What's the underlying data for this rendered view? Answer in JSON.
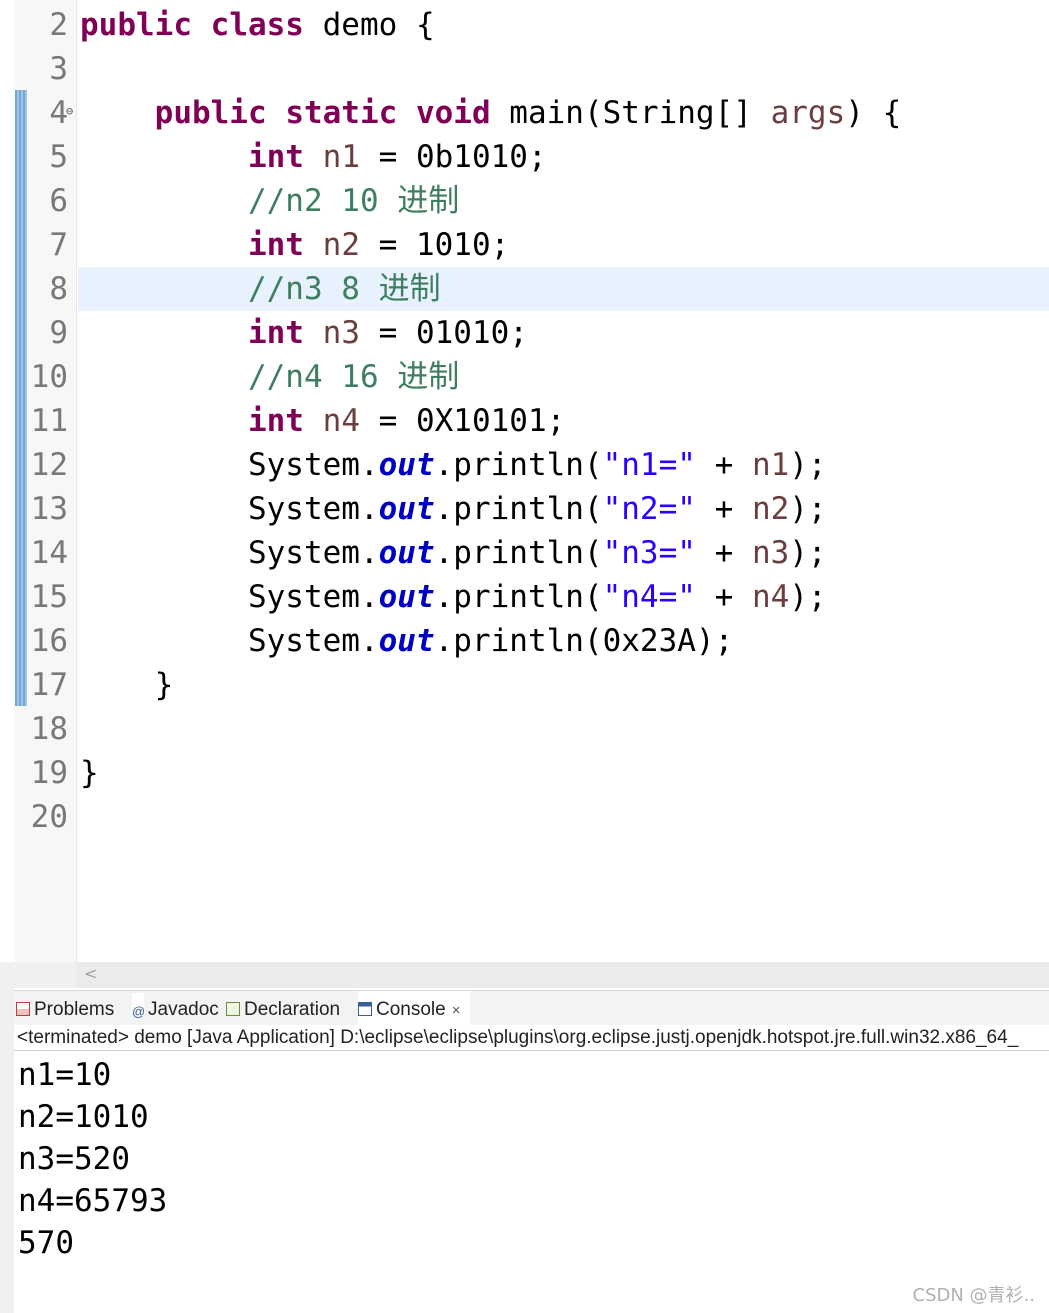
{
  "editor": {
    "highlighted_line": "8",
    "lines": [
      {
        "n": "2",
        "tokens": [
          {
            "t": "public",
            "c": "kw"
          },
          {
            "t": " "
          },
          {
            "t": "class",
            "c": "kw"
          },
          {
            "t": " demo {"
          }
        ]
      },
      {
        "n": "3",
        "tokens": []
      },
      {
        "n": "4",
        "fold": "⊖",
        "tokens": [
          {
            "t": "    "
          },
          {
            "t": "public",
            "c": "kw"
          },
          {
            "t": " "
          },
          {
            "t": "static",
            "c": "kw"
          },
          {
            "t": " "
          },
          {
            "t": "void",
            "c": "kw"
          },
          {
            "t": " main(String[] "
          },
          {
            "t": "args",
            "c": "var"
          },
          {
            "t": ") {"
          }
        ]
      },
      {
        "n": "5",
        "tokens": [
          {
            "t": "         "
          },
          {
            "t": "int",
            "c": "kw"
          },
          {
            "t": " "
          },
          {
            "t": "n1",
            "c": "var"
          },
          {
            "t": " = 0b1010;"
          }
        ]
      },
      {
        "n": "6",
        "tokens": [
          {
            "t": "         "
          },
          {
            "t": "//n2 10 进制",
            "c": "cm"
          }
        ]
      },
      {
        "n": "7",
        "tokens": [
          {
            "t": "         "
          },
          {
            "t": "int",
            "c": "kw"
          },
          {
            "t": " "
          },
          {
            "t": "n2",
            "c": "var"
          },
          {
            "t": " = 1010;"
          }
        ]
      },
      {
        "n": "8",
        "tokens": [
          {
            "t": "         "
          },
          {
            "t": "//n3 8 进制",
            "c": "cm"
          }
        ]
      },
      {
        "n": "9",
        "tokens": [
          {
            "t": "         "
          },
          {
            "t": "int",
            "c": "kw"
          },
          {
            "t": " "
          },
          {
            "t": "n3",
            "c": "var"
          },
          {
            "t": " = 01010;"
          }
        ]
      },
      {
        "n": "10",
        "tokens": [
          {
            "t": "         "
          },
          {
            "t": "//n4 16 进制",
            "c": "cm"
          }
        ]
      },
      {
        "n": "11",
        "tokens": [
          {
            "t": "         "
          },
          {
            "t": "int",
            "c": "kw"
          },
          {
            "t": " "
          },
          {
            "t": "n4",
            "c": "var"
          },
          {
            "t": " = 0X10101;"
          }
        ]
      },
      {
        "n": "12",
        "tokens": [
          {
            "t": "         System."
          },
          {
            "t": "out",
            "c": "field"
          },
          {
            "t": ".println("
          },
          {
            "t": "\"n1=\"",
            "c": "str"
          },
          {
            "t": " + "
          },
          {
            "t": "n1",
            "c": "var"
          },
          {
            "t": ");"
          }
        ]
      },
      {
        "n": "13",
        "tokens": [
          {
            "t": "         System."
          },
          {
            "t": "out",
            "c": "field"
          },
          {
            "t": ".println("
          },
          {
            "t": "\"n2=\"",
            "c": "str"
          },
          {
            "t": " + "
          },
          {
            "t": "n2",
            "c": "var"
          },
          {
            "t": ");"
          }
        ]
      },
      {
        "n": "14",
        "tokens": [
          {
            "t": "         System."
          },
          {
            "t": "out",
            "c": "field"
          },
          {
            "t": ".println("
          },
          {
            "t": "\"n3=\"",
            "c": "str"
          },
          {
            "t": " + "
          },
          {
            "t": "n3",
            "c": "var"
          },
          {
            "t": ");"
          }
        ]
      },
      {
        "n": "15",
        "tokens": [
          {
            "t": "         System."
          },
          {
            "t": "out",
            "c": "field"
          },
          {
            "t": ".println("
          },
          {
            "t": "\"n4=\"",
            "c": "str"
          },
          {
            "t": " + "
          },
          {
            "t": "n4",
            "c": "var"
          },
          {
            "t": ");"
          }
        ]
      },
      {
        "n": "16",
        "tokens": [
          {
            "t": "         System."
          },
          {
            "t": "out",
            "c": "field"
          },
          {
            "t": ".println(0x23A);"
          }
        ]
      },
      {
        "n": "17",
        "tokens": [
          {
            "t": "    }"
          }
        ]
      },
      {
        "n": "18",
        "tokens": []
      },
      {
        "n": "19",
        "tokens": [
          {
            "t": "}"
          }
        ]
      },
      {
        "n": "20",
        "tokens": []
      }
    ],
    "scroll_left_arrow": "<"
  },
  "views": {
    "tabs": [
      {
        "label": "Problems",
        "icon": "problems-icon",
        "active": false
      },
      {
        "label": "Javadoc",
        "icon": "javadoc-icon",
        "active": false
      },
      {
        "label": "Declaration",
        "icon": "declaration-icon",
        "active": false
      },
      {
        "label": "Console",
        "icon": "console-icon",
        "active": true,
        "close": "×"
      }
    ],
    "console_status": "<terminated> demo [Java Application] D:\\eclipse\\eclipse\\plugins\\org.eclipse.justj.openjdk.hotspot.jre.full.win32.x86_64_",
    "output": [
      "n1=10",
      "n2=1010",
      "n3=520",
      "n4=65793",
      "570"
    ]
  },
  "watermark": "CSDN @青衫.."
}
